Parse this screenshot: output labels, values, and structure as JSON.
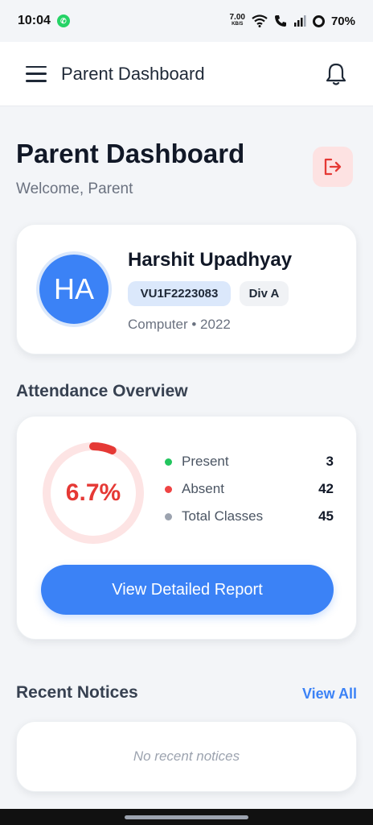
{
  "status_bar": {
    "time": "10:04",
    "net_speed": "7.00",
    "net_unit": "KB/S",
    "battery": "70%"
  },
  "app_bar": {
    "title": "Parent Dashboard"
  },
  "header": {
    "title": "Parent Dashboard",
    "welcome": "Welcome, Parent"
  },
  "student": {
    "initials": "HA",
    "name": "Harshit Upadhyay",
    "roll_no": "VU1F2223083",
    "division": "Div A",
    "meta": "Computer • 2022"
  },
  "attendance": {
    "section_title": "Attendance Overview",
    "percent_label": "6.7%",
    "percent_value": 0.067,
    "stats": [
      {
        "label": "Present",
        "value": "3",
        "color": "#22c55e"
      },
      {
        "label": "Absent",
        "value": "42",
        "color": "#ef4444"
      },
      {
        "label": "Total Classes",
        "value": "45",
        "color": "#9ca3af"
      }
    ],
    "button_label": "View Detailed Report"
  },
  "notices": {
    "section_title": "Recent Notices",
    "view_all": "View All",
    "empty_text": "No recent notices"
  },
  "colors": {
    "accent": "#3b82f6",
    "danger": "#e53935",
    "ring_track": "#fde4e4"
  }
}
